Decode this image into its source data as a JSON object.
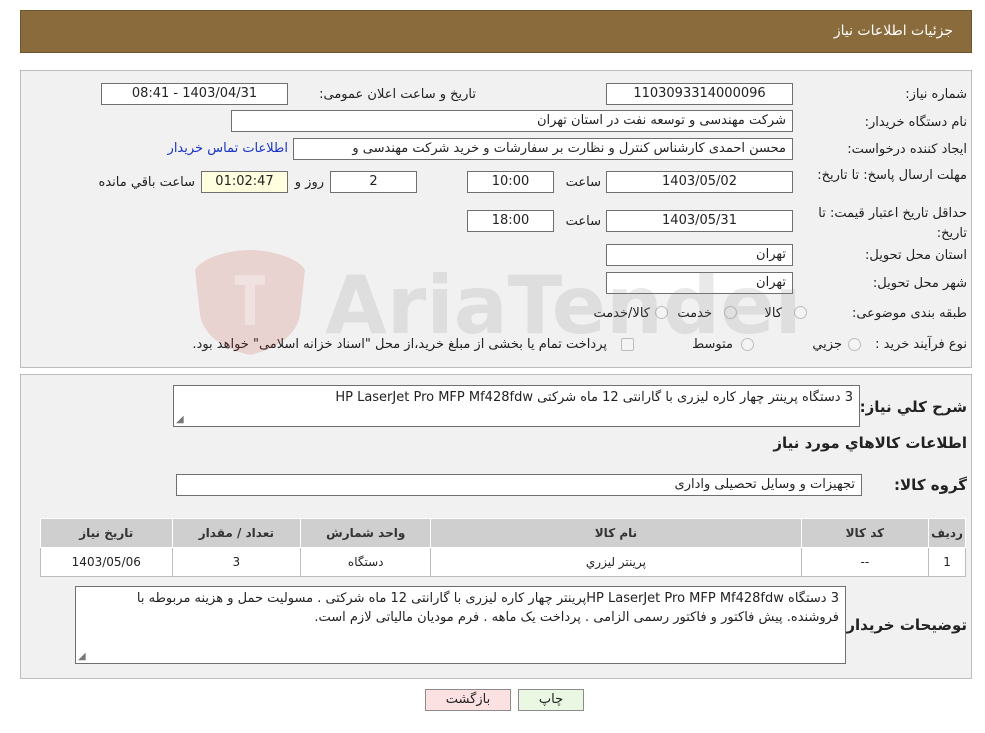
{
  "header": {
    "title": "جزئیات اطلاعات نیاز"
  },
  "form": {
    "need_number": {
      "label": "شماره نیاز:",
      "value": "1103093314000096"
    },
    "announce": {
      "label": "تاریخ و ساعت اعلان عمومی:",
      "value": "1403/04/31 - 08:41"
    },
    "buyer_org": {
      "label": "نام دستگاه خریدار:",
      "value": "شرکت مهندسی و توسعه نفت در استان تهران"
    },
    "creator": {
      "label": "ایجاد کننده درخواست:",
      "value": "محسن احمدی کارشناس کنترل و نظارت بر سفارشات و خرید شرکت مهندسی و",
      "contact_link": "اطلاعات تماس خریدار"
    },
    "reply_deadline": {
      "label": "مهلت ارسال پاسخ: تا تاریخ:",
      "date": "1403/05/02",
      "time_label": "ساعت",
      "time": "10:00",
      "days": "2",
      "days_label": "روز و",
      "remaining": "01:02:47",
      "remaining_label": "ساعت باقي مانده"
    },
    "price_validity": {
      "label": "حداقل تاریخ اعتبار قیمت: تا تاریخ:",
      "date": "1403/05/31",
      "time_label": "ساعت",
      "time": "18:00"
    },
    "province": {
      "label": "استان محل تحویل:",
      "value": "تهران"
    },
    "city": {
      "label": "شهر محل تحویل:",
      "value": "تهران"
    },
    "category": {
      "label": "طبقه بندی موضوعی:",
      "options": [
        "کالا",
        "خدمت",
        "کالا/خدمت"
      ]
    },
    "process": {
      "label": "نوع فرآیند خرید :",
      "options": [
        "جزيي",
        "متوسط"
      ],
      "note": "پرداخت تمام یا بخشی از مبلغ خرید،از محل \"اسناد خزانه اسلامی\" خواهد بود."
    }
  },
  "summary": {
    "label": "شرح کلي نياز:",
    "value": "3 دستگاه پرینتر چهار کاره لیزری با گارانتی 12 ماه شرکتی HP LaserJet Pro MFP Mf428fdw"
  },
  "goods": {
    "title": "اطلاعات کالاهاي مورد نياز",
    "group_label": "گروه کالا:",
    "group_value": "تجهیزات و وسایل تحصیلی واداری",
    "table": {
      "headers": [
        "رديف",
        "کد کالا",
        "نام کالا",
        "واحد شمارش",
        "تعداد / مقدار",
        "تاریخ نیاز"
      ],
      "rows": [
        [
          "1",
          "--",
          "پرينتر ليزري",
          "دستگاه",
          "3",
          "1403/05/06"
        ]
      ]
    },
    "buyer_notes_label": "توضيحات خريدار:",
    "buyer_notes": "3 دستگاه HP LaserJet Pro MFP Mf428fdwپرینتر چهار کاره لیزری با گارانتی 12 ماه شرکتی . مسولیت حمل و هزینه مربوطه با فروشنده. پیش فاکتور و فاکتور رسمی الزامی . پرداخت یک ماهه . فرم مودیان مالیاتی لازم است."
  },
  "buttons": {
    "print": "چاپ",
    "back": "بازگشت"
  },
  "watermark": {
    "text": "AriaTender.neT"
  }
}
